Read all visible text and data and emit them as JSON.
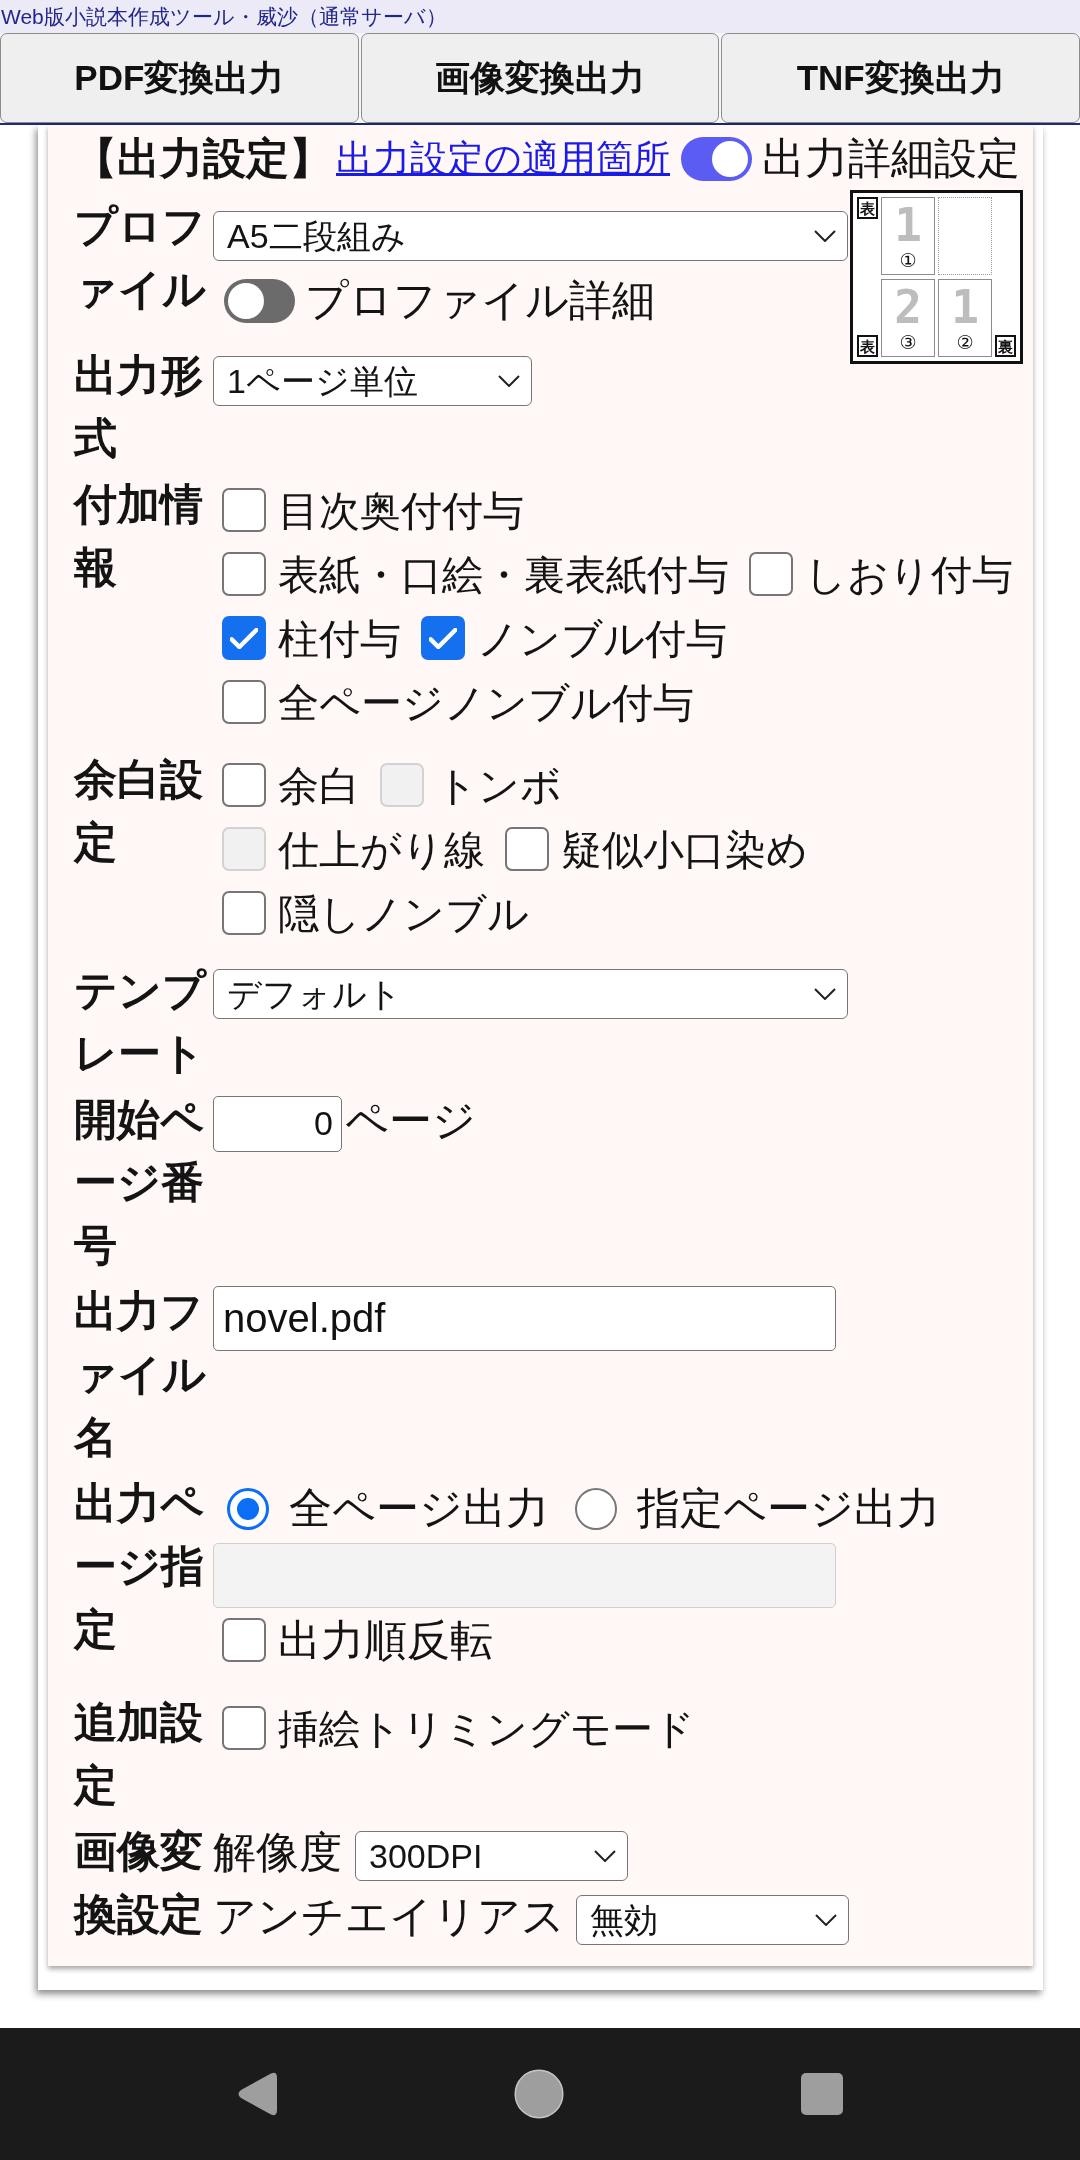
{
  "site_title": "Web版小説本作成ツール・威沙（通常サーバ）",
  "export_buttons": [
    {
      "label": "PDF変換出力"
    },
    {
      "label": "画像変換出力"
    },
    {
      "label": "TNF変換出力"
    }
  ],
  "output_settings": {
    "heading": "【出力設定】",
    "help_link": "出力設定の適用箇所",
    "details_toggle": {
      "label": "出力詳細設定",
      "on": true
    }
  },
  "layout_preview": {
    "corner_marks": [
      {
        "kind": "top_left",
        "text": "表"
      },
      {
        "kind": "bottom_left",
        "text": "表"
      },
      {
        "kind": "bottom_right",
        "text": "裏"
      }
    ],
    "slots": [
      {
        "kind": "page",
        "number": "1",
        "order": "①"
      },
      {
        "kind": "blank"
      },
      {
        "kind": "page",
        "number": "2",
        "order": "③"
      },
      {
        "kind": "page",
        "number": "1",
        "order": "②"
      }
    ]
  },
  "rows": [
    {
      "kind": "profile",
      "label": "プロファイル",
      "select": "A5二段組み",
      "toggle": {
        "label": "プロファイル詳細",
        "on": false
      }
    },
    {
      "kind": "select",
      "label": "出力形式",
      "select": "1ページ単位"
    },
    {
      "kind": "checkboxes",
      "label": "付加情報",
      "options": [
        {
          "label": "目次奥付付与",
          "checked": false
        },
        {
          "label": "表紙・口絵・裏表紙付与",
          "checked": false
        },
        {
          "label": "しおり付与",
          "checked": false
        },
        {
          "label": "柱付与",
          "checked": true
        },
        {
          "label": "ノンブル付与",
          "checked": true
        },
        {
          "label": "全ページノンブル付与",
          "checked": false
        }
      ]
    },
    {
      "kind": "margins",
      "label": "余白設定",
      "options": [
        {
          "label": "余白",
          "checked": false,
          "disabled": false
        },
        {
          "label": "トンボ",
          "checked": false,
          "disabled": true
        },
        {
          "label": "仕上がり線",
          "checked": false,
          "disabled": true
        },
        {
          "label": "疑似小口染め",
          "checked": false,
          "disabled": false
        },
        {
          "label": "隠しノンブル",
          "checked": false,
          "disabled": false
        }
      ]
    },
    {
      "kind": "wide_select",
      "label": "テンプレート",
      "select": "デフォルト"
    },
    {
      "kind": "number",
      "label": "開始ページ番号",
      "value": "0",
      "unit": "ページ"
    },
    {
      "kind": "text",
      "label": "出力ファイル名",
      "value": "novel.pdf"
    },
    {
      "kind": "page_range",
      "label": "出力ページ指定",
      "choices": [
        {
          "label": "全ページ出力",
          "selected": true
        },
        {
          "label": "指定ページ出力",
          "selected": false
        }
      ],
      "range_field": {
        "disabled": true
      },
      "reverse": {
        "label": "出力順反転",
        "checked": false
      }
    },
    {
      "kind": "checkboxes",
      "label": "追加設定",
      "options": [
        {
          "label": "挿絵トリミングモード",
          "checked": false
        }
      ]
    },
    {
      "kind": "image",
      "label": "画像変換設定",
      "resolution": {
        "label": "解像度",
        "value": "300DPI"
      },
      "antialias": {
        "label": "アンチエイリアス",
        "value": "無効"
      }
    }
  ]
}
